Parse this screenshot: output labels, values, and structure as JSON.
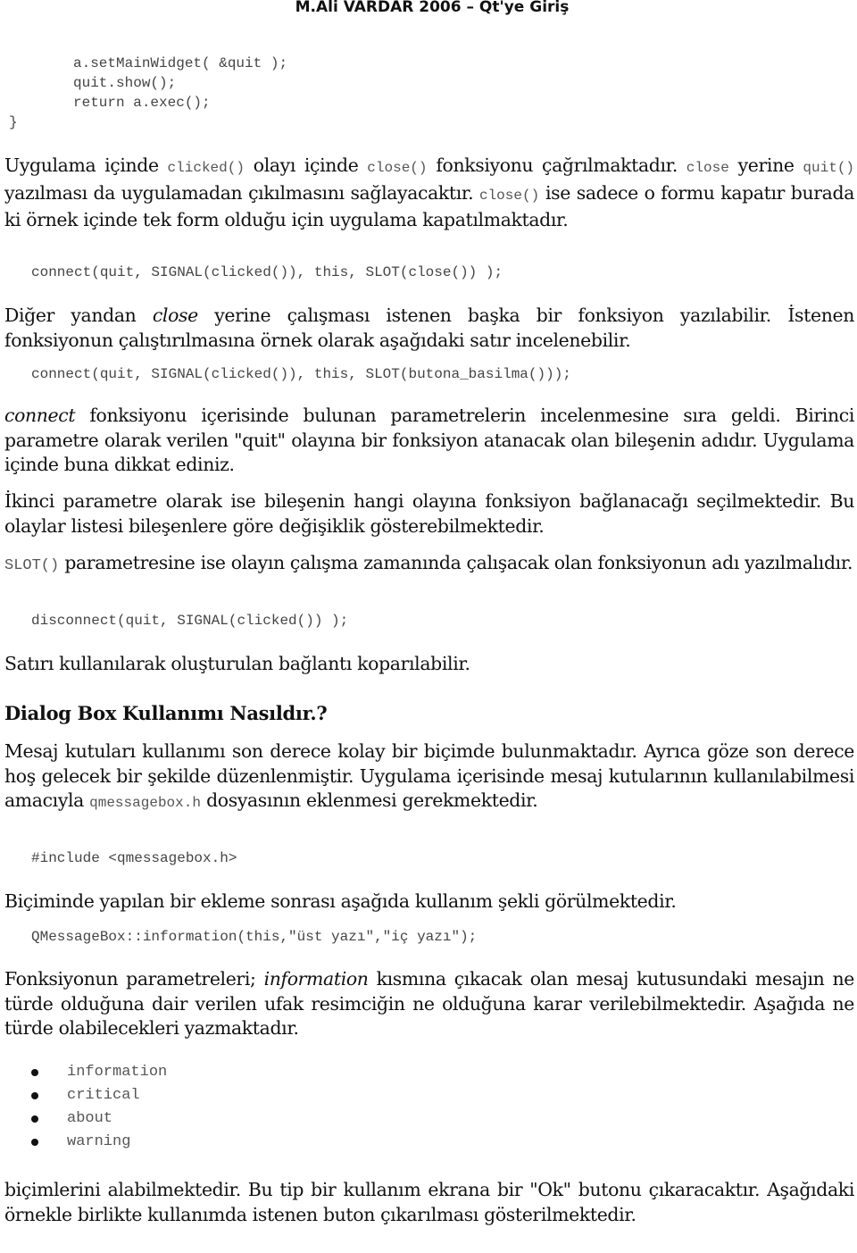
{
  "header": {
    "title": "M.Ali VARDAR 2006 – Qt'ye Giriş"
  },
  "code_top": {
    "line1": "a.setMainWidget( &quit );",
    "line2": "quit.show();",
    "line3": "return a.exec();",
    "line4": "}"
  },
  "para1": {
    "t1": "Uygulama içinde ",
    "c1": "clicked()",
    "t2": " olayı içinde ",
    "c2": "close()",
    "t3": " fonksiyonu çağrılmaktadır. ",
    "c3": "close",
    "t4": " yerine ",
    "c4": "quit()",
    "t5": " yazılması da uygulamadan çıkılmasını sağlayacaktır. ",
    "c5": "close()",
    "t6": " ise sadece o formu kapatır burada ki örnek içinde tek form olduğu için uygulama kapatılmaktadır."
  },
  "code_connect1": "connect(quit, SIGNAL(clicked()), this, SLOT(close()) );",
  "para2": {
    "t1": "Diğer yandan ",
    "em1": "close",
    "t2": " yerine çalışması istenen başka bir fonksiyon yazılabilir. İstenen fonksiyonun çalıştırılmasına örnek olarak aşağıdaki satır incelenebilir."
  },
  "code_connect2": "connect(quit, SIGNAL(clicked()), this, SLOT(butona_basilma()));",
  "para3": {
    "em1": "connect",
    "t1": " fonksiyonu içerisinde bulunan parametrelerin incelenmesine sıra geldi. Birinci parametre olarak verilen \"quit\" olayına bir fonksiyon atanacak olan bileşenin adıdır. Uygulama içinde buna dikkat ediniz."
  },
  "para4": "İkinci parametre olarak ise bileşenin hangi olayına fonksiyon bağlanacağı seçilmektedir. Bu olaylar listesi bileşenlere göre değişiklik gösterebilmektedir.",
  "para5": {
    "c1": "SLOT()",
    "t1": " parametresine ise olayın çalışma zamanında çalışacak olan fonksiyonun adı yazılmalıdır."
  },
  "code_disconnect": "disconnect(quit, SIGNAL(clicked()) );",
  "para6": "Satırı kullanılarak oluşturulan bağlantı koparılabilir.",
  "heading": "Dialog Box Kullanımı Nasıldır.?",
  "para7": {
    "t1": "Mesaj kutuları kullanımı son derece kolay bir biçimde bulunmaktadır. Ayrıca göze son derece hoş gelecek bir şekilde düzenlenmiştir. Uygulama içerisinde mesaj kutularının kullanılabilmesi amacıyla ",
    "c1": "qmessagebox.h",
    "t2": " dosyasının eklenmesi gerekmektedir."
  },
  "code_include": "#include <qmessagebox.h>",
  "para8": "Biçiminde yapılan bir ekleme sonrası aşağıda kullanım şekli görülmektedir.",
  "code_qmessagebox": "QMessageBox::information(this,\"üst yazı\",\"iç yazı\");",
  "para9": {
    "t1": "Fonksiyonun parametreleri; ",
    "em1": "information",
    "t2": " kısmına çıkacak olan mesaj kutusundaki mesajın ne türde olduğuna dair verilen ufak resimciğin ne olduğuna karar verilebilmektedir. Aşağıda ne türde olabilecekleri yazmaktadır."
  },
  "bullets": [
    "information",
    "critical",
    "about",
    "warning"
  ],
  "para10": "biçimlerini alabilmektedir. Bu tip bir kullanım ekrana bir \"Ok\" butonu çıkaracaktır. Aşağıdaki örnekle birlikte kullanımda istenen buton çıkarılması gösterilmektedir."
}
